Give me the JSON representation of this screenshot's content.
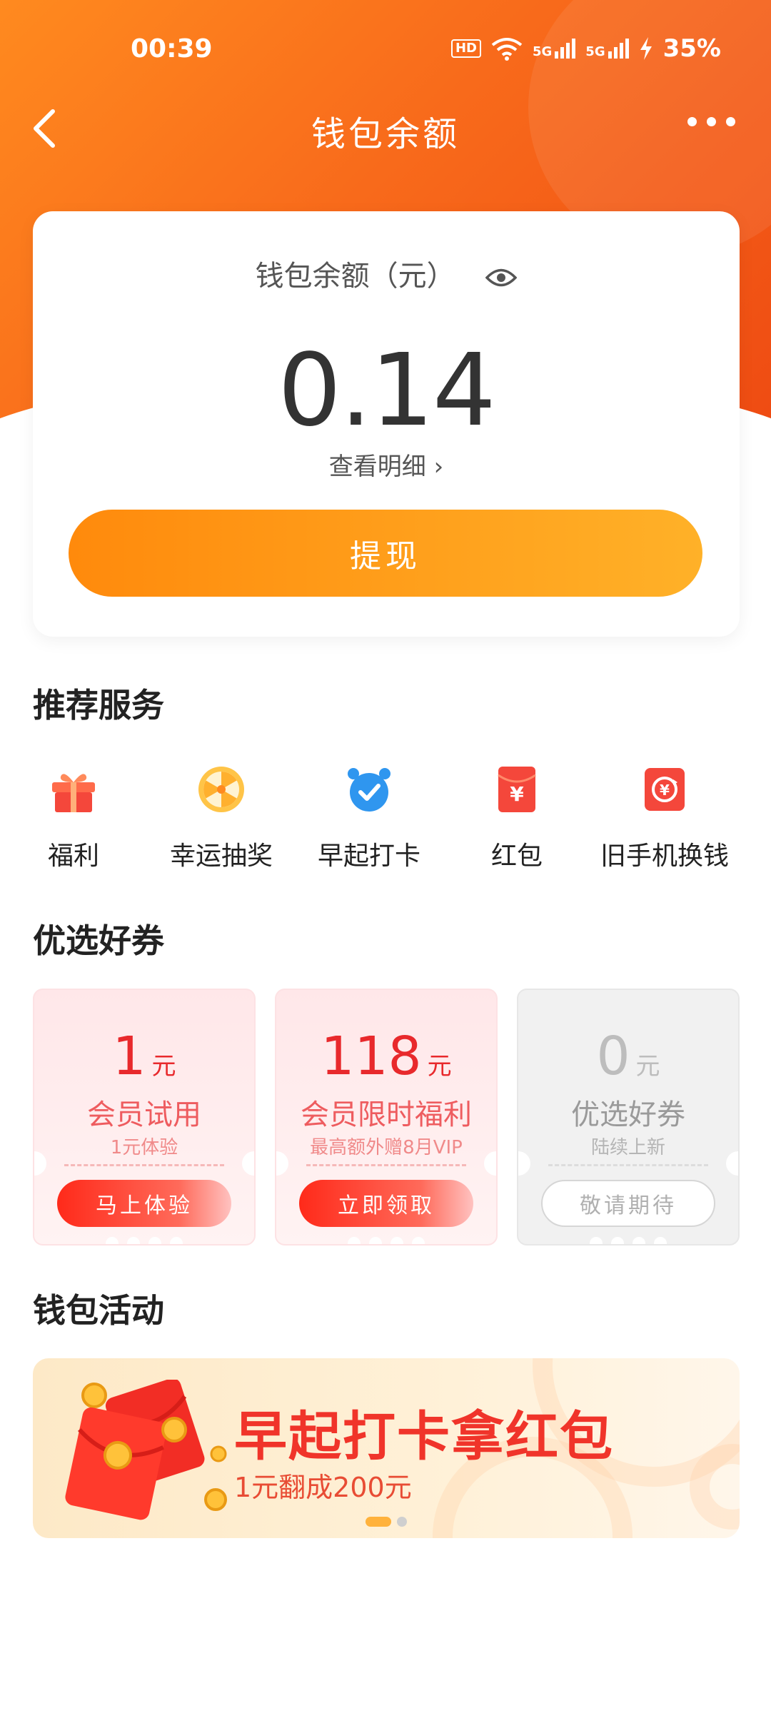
{
  "status_bar": {
    "time": "00:39",
    "hd": "HD",
    "net1": "5G",
    "net2": "5G",
    "battery": "35%"
  },
  "nav": {
    "title": "钱包余额"
  },
  "balance_card": {
    "label": "钱包余额（元）",
    "amount": "0.14",
    "detail_link": "查看明细 ›",
    "withdraw_label": "提现"
  },
  "recommended": {
    "title": "推荐服务",
    "items": [
      {
        "label": "福利",
        "icon": "gift-icon"
      },
      {
        "label": "幸运抽奖",
        "icon": "lucky-wheel-icon"
      },
      {
        "label": "早起打卡",
        "icon": "alarm-clock-icon"
      },
      {
        "label": "红包",
        "icon": "red-envelope-icon"
      },
      {
        "label": "旧手机换钱",
        "icon": "recycle-money-icon"
      }
    ]
  },
  "coupons": {
    "title": "优选好券",
    "items": [
      {
        "amount": "1",
        "unit": "元",
        "name": "会员试用",
        "sub": "1元体验",
        "button": "马上体验"
      },
      {
        "amount": "118",
        "unit": "元",
        "name": "会员限时福利",
        "sub": "最高额外赠8月VIP",
        "button": "立即领取"
      },
      {
        "amount": "0",
        "unit": "元",
        "name": "优选好券",
        "sub": "陆续上新",
        "button": "敬请期待"
      }
    ]
  },
  "activities": {
    "title": "钱包活动",
    "banner_title": "早起打卡拿红包",
    "banner_sub": "1元翻成200元"
  },
  "colors": {
    "brand": "#f86a1b",
    "accent": "#ff9a1a",
    "coupon_red": "#e8292c"
  }
}
